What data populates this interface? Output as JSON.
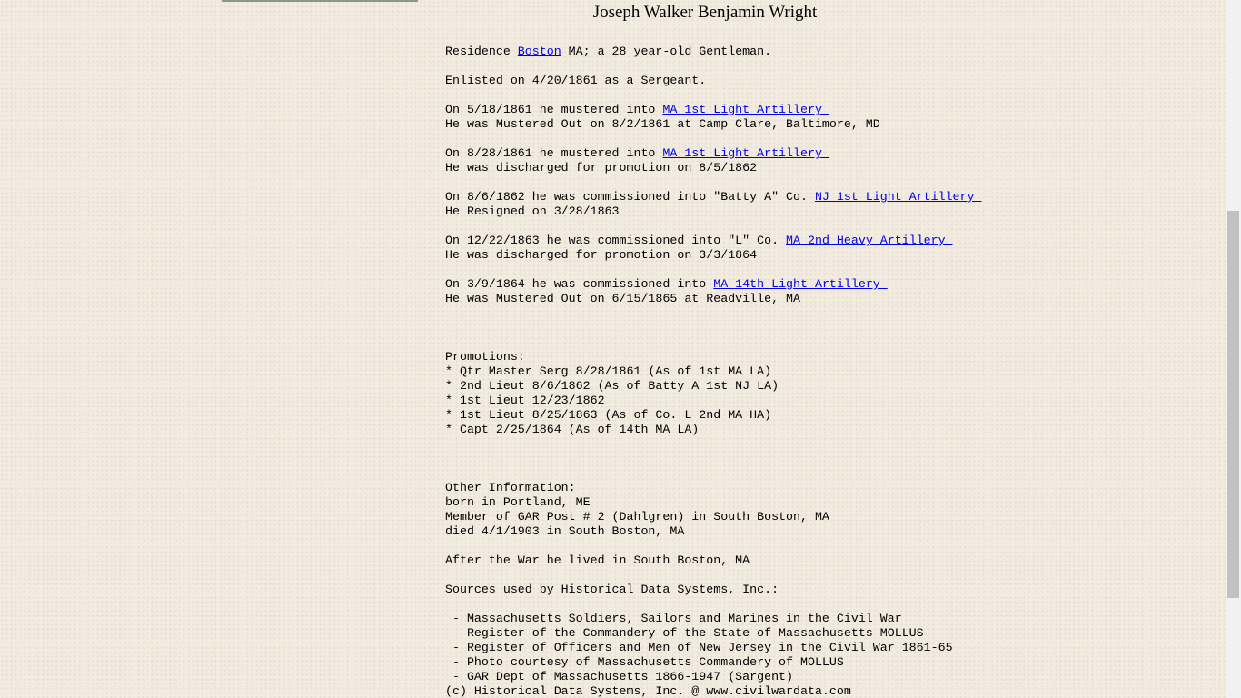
{
  "title": "Joseph Walker Benjamin Wright",
  "residence": {
    "prefix": "Residence ",
    "city_link": "Boston",
    "suffix": " MA; a 28 year-old Gentleman."
  },
  "enlisted": "Enlisted on 4/20/1861 as a Sergeant.",
  "service": [
    {
      "prefix": "On 5/18/1861 he mustered into ",
      "unit_link": "MA 1st Light Artillery ",
      "outcome": "He was Mustered Out on 8/2/1861 at Camp Clare, Baltimore, MD"
    },
    {
      "prefix": "On 8/28/1861 he mustered into ",
      "unit_link": "MA 1st Light Artillery ",
      "outcome": "He was discharged for promotion on 8/5/1862"
    },
    {
      "prefix": "On 8/6/1862 he was commissioned into \"Batty A\" Co. ",
      "unit_link": "NJ 1st Light Artillery ",
      "outcome": "He Resigned on 3/28/1863"
    },
    {
      "prefix": "On 12/22/1863 he was commissioned into \"L\" Co. ",
      "unit_link": "MA 2nd Heavy Artillery ",
      "outcome": "He was discharged for promotion on 3/3/1864"
    },
    {
      "prefix": "On 3/9/1864 he was commissioned into ",
      "unit_link": "MA 14th Light Artillery ",
      "outcome": "He was Mustered Out on 6/15/1865 at Readville, MA"
    }
  ],
  "promotions": {
    "heading": "Promotions:",
    "items": [
      "* Qtr Master Serg 8/28/1861 (As of 1st MA LA)",
      "* 2nd Lieut 8/6/1862 (As of Batty A 1st NJ LA)",
      "* 1st Lieut 12/23/1862",
      "* 1st Lieut 8/25/1863 (As of Co. L 2nd MA HA)",
      "* Capt 2/25/1864 (As of 14th MA LA)"
    ]
  },
  "other_info": {
    "heading": "Other Information:",
    "items": [
      "born in Portland, ME",
      "Member of GAR Post # 2 (Dahlgren) in South Boston, MA",
      "died 4/1/1903 in South Boston, MA"
    ]
  },
  "after_war": "After the War he lived in South Boston, MA",
  "sources": {
    "heading": "Sources used by Historical Data Systems, Inc.:",
    "items": [
      " - Massachusetts Soldiers, Sailors and Marines in the Civil War",
      " - Register of the Commandery of the State of Massachusetts MOLLUS",
      " - Register of Officers and Men of New Jersey in the Civil War 1861-65",
      " - Photo courtesy of Massachusetts Commandery of MOLLUS",
      " - GAR Dept of Massachusetts 1866-1947 (Sargent)"
    ]
  },
  "copyright": "(c) Historical Data Systems, Inc. @ www.civilwardata.com"
}
